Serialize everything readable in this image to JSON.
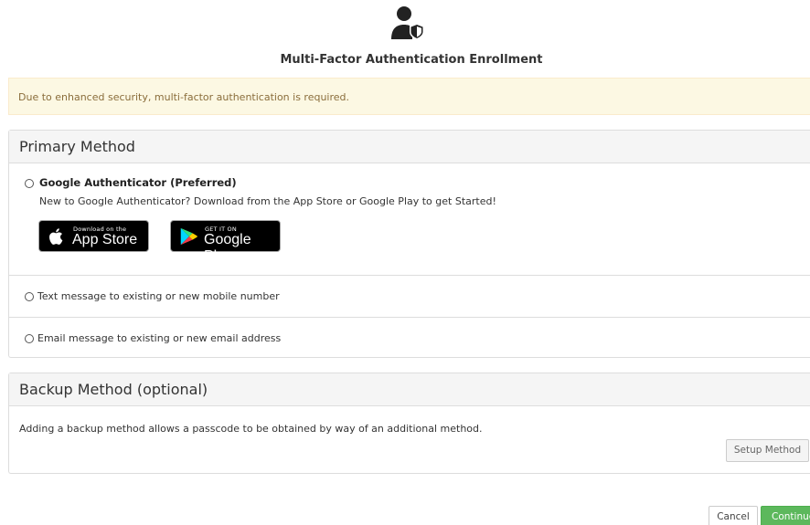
{
  "header": {
    "icon": "user-shield-icon",
    "title": "Multi-Factor Authentication Enrollment"
  },
  "alert": {
    "message": "Due to enhanced security, multi-factor authentication is required.",
    "background": "#fcf8e3",
    "text_color": "#8a6d3b"
  },
  "primary_method": {
    "heading": "Primary Method",
    "options": [
      {
        "label": "Google Authenticator (Preferred)",
        "description": "New to Google Authenticator? Download from the App Store or Google Play to get Started!",
        "selected": false
      },
      {
        "label": "Text message to existing or new mobile number",
        "selected": false
      },
      {
        "label": "Email message to existing or new email address",
        "selected": false
      }
    ],
    "badges": {
      "app_store": {
        "small": "Download on the",
        "large": "App Store",
        "icon": "apple-icon"
      },
      "google_play": {
        "small": "GET IT ON",
        "large": "Google Play",
        "icon": "google-play-icon"
      }
    }
  },
  "backup_method": {
    "heading": "Backup Method (optional)",
    "description": "Adding a backup method allows a passcode to be obtained by way of an additional method.",
    "setup_label": "Setup Method"
  },
  "footer": {
    "cancel_label": "Cancel",
    "continue_label": "Continue",
    "continue_color": "#5cb85c"
  }
}
